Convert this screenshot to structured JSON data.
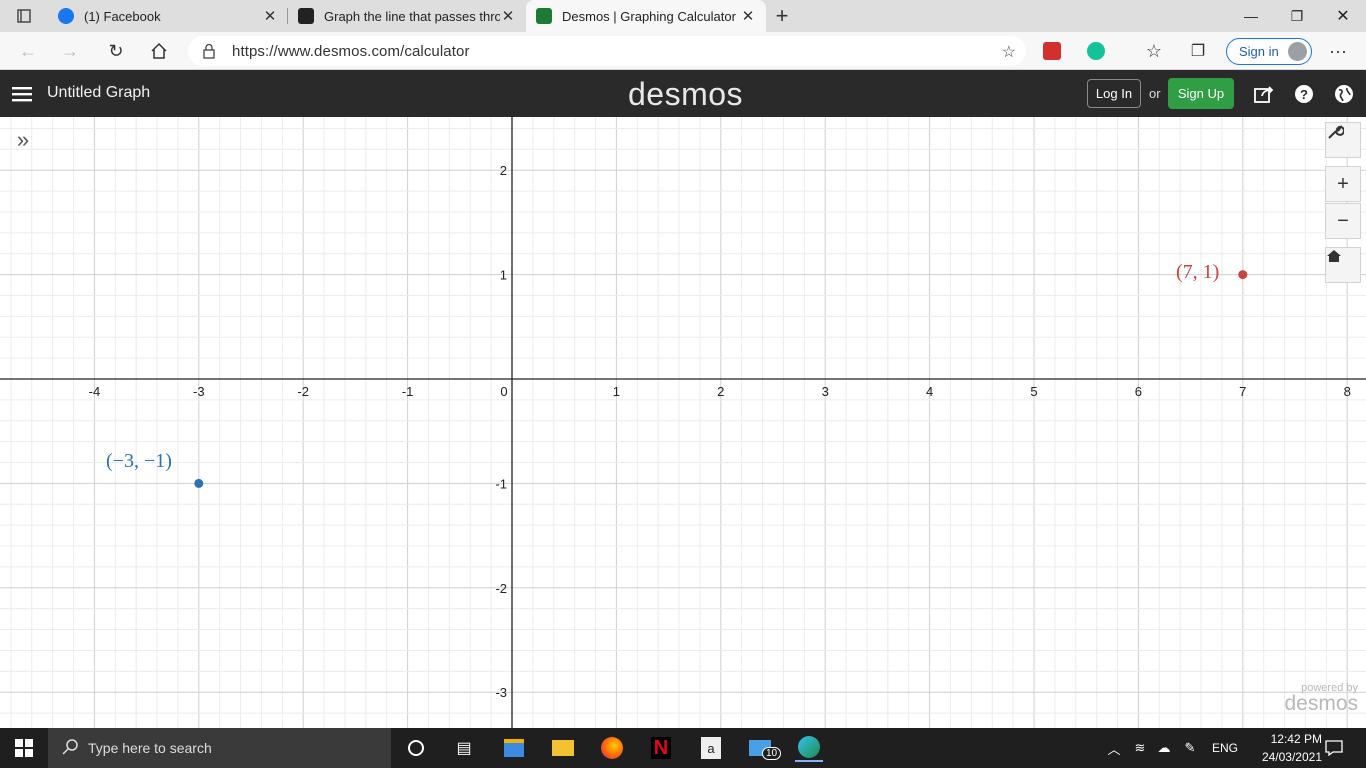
{
  "browser": {
    "tabs": [
      {
        "title": "(1) Facebook",
        "icon": "facebook-icon",
        "active": false
      },
      {
        "title": "Graph the line that passes throu",
        "icon": "brainly-icon",
        "active": false
      },
      {
        "title": "Desmos | Graphing Calculator",
        "icon": "desmos-icon",
        "active": true
      }
    ],
    "url": "https://www.desmos.com/calculator",
    "signin_label": "Sign in"
  },
  "desmos": {
    "graph_title": "Untitled Graph",
    "logo": "desmos",
    "login_label": "Log In",
    "or_label": "or",
    "signup_label": "Sign Up",
    "powered_by": "powered by",
    "powered_logo": "desmos",
    "colors": {
      "header": "#2a2a2a",
      "signup": "#2f9e44",
      "point_red": "#c74440",
      "point_blue": "#2d70b3"
    }
  },
  "graph": {
    "x_ticks": [
      "-4",
      "-3",
      "-2",
      "-1",
      "0",
      "1",
      "2",
      "3",
      "4",
      "5",
      "6",
      "7",
      "8"
    ],
    "y_ticks": [
      "2",
      "1",
      "-1",
      "-2",
      "-3"
    ],
    "points": [
      {
        "label": "(7, 1)",
        "x": 7,
        "y": 1,
        "color": "#c74440",
        "label_side": "left"
      },
      {
        "label": "(−3, −1)",
        "x": -3,
        "y": -1,
        "color": "#2d70b3",
        "label_side": "above"
      }
    ]
  },
  "taskbar": {
    "search_placeholder": "Type here to search",
    "language": "ENG",
    "time": "12:42 PM",
    "date": "24/03/2021",
    "mail_badge": "10"
  }
}
